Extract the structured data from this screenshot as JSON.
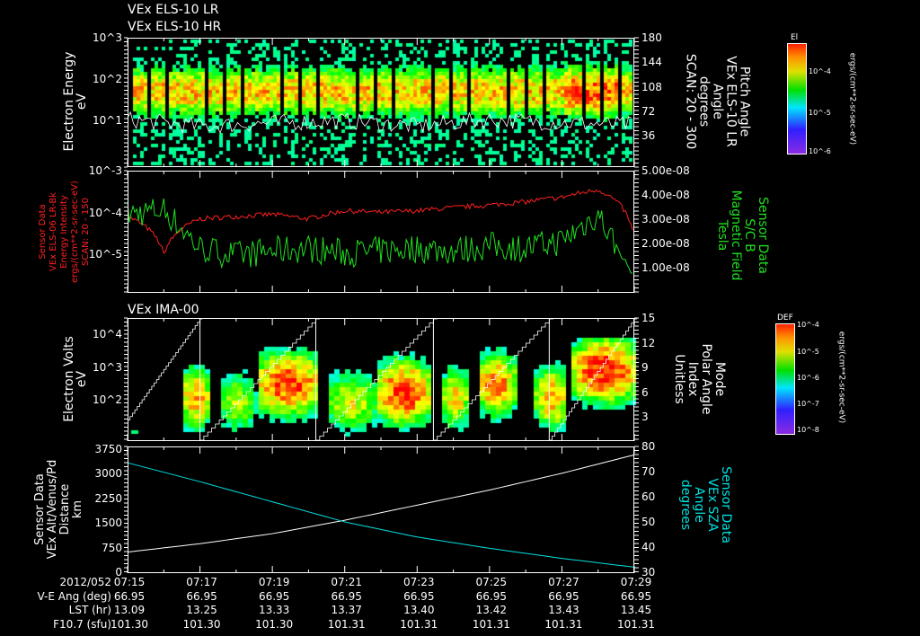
{
  "titles": {
    "p1a": "VEx ELS-10 LR",
    "p1b": "VEx ELS-10 HR",
    "p3": "VEx IMA-00"
  },
  "panel1": {
    "ylabel": [
      "Electron Energy",
      "eV"
    ],
    "yticks": [
      "10^3",
      "10^2",
      "10^1"
    ],
    "rticks": [
      "180",
      "144",
      "108",
      "72",
      "36"
    ],
    "rlabel": [
      "Pitch Angle",
      "VEx ELS-10 LR",
      "Angle",
      "degrees",
      "SCAN: 20 - 300"
    ],
    "colorbar": {
      "title": "El",
      "ticks": [
        "10^-4",
        "10^-5",
        "10^-6"
      ],
      "units": "ergs/(cm**2-sr-sec-eV)"
    }
  },
  "panel2": {
    "ylabel": [
      "Sensor Data",
      "VEx ELS-06 LR-Bk",
      "Energy Intensity",
      "ergs/(cm**2-sr-sec-eV)",
      "SCAN: 20 - 150"
    ],
    "yticks": [
      "10^-3",
      "10^-4",
      "10^-5"
    ],
    "rticks": [
      "5.00e-08",
      "4.00e-08",
      "3.00e-08",
      "2.00e-08",
      "1.00e-08"
    ],
    "rlabel": [
      "Sensor Data",
      "S/C B",
      "Magnetic Field",
      "Tesla"
    ]
  },
  "panel3": {
    "ylabel": [
      "Electron Volts",
      "eV"
    ],
    "yticks": [
      "10^4",
      "10^3",
      "10^2"
    ],
    "rticks": [
      "15",
      "12",
      "9",
      "6",
      "3"
    ],
    "rlabel": [
      "Mode",
      "Polar Angle",
      "Index",
      "Unitless"
    ],
    "colorbar": {
      "title": "DEF",
      "ticks": [
        "10^-4",
        "10^-5",
        "10^-6",
        "10^-7",
        "10^-8"
      ],
      "units": "ergs/(cm**2-sr-sec-eV)"
    }
  },
  "panel4": {
    "ylabel": [
      "Sensor Data",
      "VEx Alt/Venus/Pd",
      "Distance",
      "km"
    ],
    "yticks": [
      "3750",
      "3000",
      "2250",
      "1500",
      "750",
      "0"
    ],
    "rticks": [
      "80",
      "70",
      "60",
      "50",
      "40",
      "30"
    ],
    "rlabel": [
      "Sensor Data",
      "VEx SZA",
      "Angle",
      "degrees"
    ]
  },
  "footer": {
    "rows": [
      {
        "label": "2012/052",
        "values": [
          "07:15",
          "07:17",
          "07:19",
          "07:21",
          "07:23",
          "07:25",
          "07:27",
          "07:29"
        ]
      },
      {
        "label": "V-E Ang (deg)",
        "values": [
          "66.95",
          "66.95",
          "66.95",
          "66.95",
          "66.95",
          "66.95",
          "66.95",
          "66.95"
        ]
      },
      {
        "label": "LST (hr)",
        "values": [
          "13.09",
          "13.25",
          "13.33",
          "13.37",
          "13.40",
          "13.42",
          "13.43",
          "13.45"
        ]
      },
      {
        "label": "F10.7 (sfu)",
        "values": [
          "101.30",
          "101.30",
          "101.30",
          "101.31",
          "101.31",
          "101.31",
          "101.31",
          "101.31"
        ]
      }
    ]
  },
  "colors": {
    "red": "#ff2020",
    "green": "#20e020",
    "cyan": "#00e0e0",
    "white": "#ffffff"
  },
  "chart_data": [
    {
      "type": "heatmap",
      "title": "VEx ELS-10 LR",
      "ylabel": "Electron Energy (eV)",
      "yscale": "log",
      "ylim": [
        1,
        1000
      ],
      "xlim": [
        "07:15",
        "07:29"
      ],
      "peak_energy_eV": 40,
      "overlay": {
        "name": "Pitch Angle",
        "ylim": [
          0,
          180
        ],
        "x": [
          "07:15",
          "07:17",
          "07:19",
          "07:21",
          "07:23",
          "07:25",
          "07:27",
          "07:29"
        ],
        "y": [
          60,
          50,
          55,
          58,
          50,
          60,
          55,
          52
        ]
      }
    },
    {
      "type": "line",
      "xlim": [
        "07:15",
        "07:29"
      ],
      "x": [
        "07:15",
        "07:16",
        "07:17",
        "07:18",
        "07:19",
        "07:20",
        "07:21",
        "07:22",
        "07:23",
        "07:24",
        "07:25",
        "07:26",
        "07:27",
        "07:28",
        "07:29"
      ],
      "series": [
        {
          "name": "Energy Intensity",
          "axis": "left",
          "yscale": "log",
          "ylim": [
            1e-06,
            0.001
          ],
          "color": "#ff2020",
          "values": [
            8e-05,
            1e-05,
            7e-05,
            8e-05,
            9e-05,
            7e-05,
            0.00011,
            0.0001,
            0.00011,
            0.00013,
            0.00015,
            0.00018,
            0.00023,
            0.00035,
            1.8e-05
          ]
        },
        {
          "name": "Magnetic Field",
          "axis": "right",
          "ylim": [
            0,
            5e-08
          ],
          "color": "#20e020",
          "values": [
            3.2e-08,
            3.4e-08,
            1.8e-08,
            1.5e-08,
            1.7e-08,
            1.8e-08,
            1.6e-08,
            1.7e-08,
            1.8e-08,
            1.7e-08,
            1.9e-08,
            1.8e-08,
            2.1e-08,
            3.2e-08,
            6e-09
          ]
        }
      ]
    },
    {
      "type": "heatmap",
      "title": "VEx IMA-00",
      "ylabel": "Electron Volts (eV)",
      "yscale": "log",
      "ylim": [
        10,
        50000
      ],
      "xlim": [
        "07:15",
        "07:29"
      ],
      "overlay": {
        "name": "Polar Angle Index",
        "ylim": [
          0,
          15
        ],
        "sweep_boundaries": [
          "07:17",
          "07:20",
          "07:23",
          "07:26"
        ]
      }
    },
    {
      "type": "line",
      "xlim": [
        "07:15",
        "07:29"
      ],
      "x": [
        "07:15",
        "07:17",
        "07:19",
        "07:21",
        "07:23",
        "07:25",
        "07:27",
        "07:29"
      ],
      "series": [
        {
          "name": "VEx Alt/Venus/Pd",
          "axis": "left",
          "ylim": [
            0,
            3750
          ],
          "color": "#ffffff",
          "values": [
            600,
            850,
            1150,
            1550,
            2000,
            2450,
            2950,
            3500
          ]
        },
        {
          "name": "VEx SZA",
          "axis": "right",
          "ylim": [
            30,
            80
          ],
          "color": "#00e0e0",
          "values": [
            73.5,
            66,
            58,
            50,
            44,
            39.5,
            35.5,
            32
          ]
        }
      ]
    }
  ]
}
